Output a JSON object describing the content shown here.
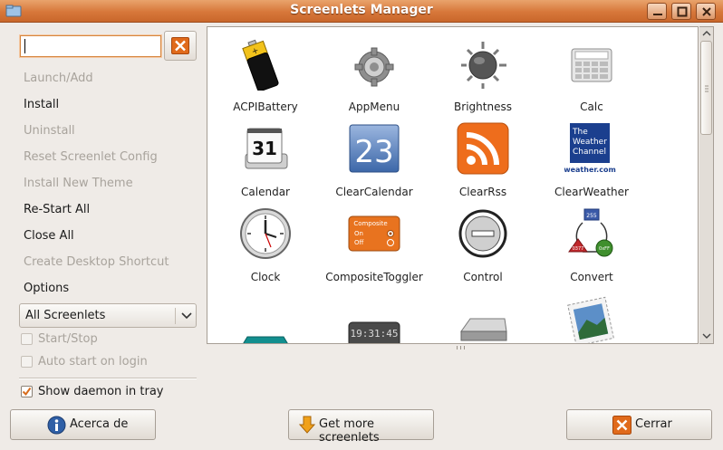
{
  "window": {
    "title": "Screenlets Manager"
  },
  "search": {
    "value": "",
    "placeholder": ""
  },
  "menu": [
    {
      "label": "Launch/Add",
      "enabled": false
    },
    {
      "label": "Install",
      "enabled": true
    },
    {
      "label": "Uninstall",
      "enabled": false
    },
    {
      "label": "Reset Screenlet Config",
      "enabled": false
    },
    {
      "label": "Install New Theme",
      "enabled": false
    },
    {
      "label": "Re-Start All",
      "enabled": true
    },
    {
      "label": "Close All",
      "enabled": true
    },
    {
      "label": "Create Desktop Shortcut",
      "enabled": false
    },
    {
      "label": "Options",
      "enabled": true
    }
  ],
  "filter": {
    "selected": "All Screenlets"
  },
  "options": {
    "start_stop": {
      "label": "Start/Stop",
      "checked": false,
      "enabled": false
    },
    "auto_start": {
      "label": "Auto start on login",
      "checked": false,
      "enabled": false
    },
    "daemon": {
      "label": "Show daemon in tray",
      "checked": true,
      "enabled": true
    }
  },
  "screenlets": [
    {
      "name": "ACPIBattery",
      "icon": "battery-icon"
    },
    {
      "name": "AppMenu",
      "icon": "gear-icon"
    },
    {
      "name": "Brightness",
      "icon": "brightness-icon"
    },
    {
      "name": "Calc",
      "icon": "calculator-icon"
    },
    {
      "name": "Calendar",
      "icon": "calendar-icon",
      "text": "31"
    },
    {
      "name": "ClearCalendar",
      "icon": "clear-calendar-icon",
      "text": "23"
    },
    {
      "name": "ClearRss",
      "icon": "rss-icon"
    },
    {
      "name": "ClearWeather",
      "icon": "weather-channel-icon",
      "text": [
        "The",
        "Weather",
        "Channel",
        "weather.com"
      ]
    },
    {
      "name": "Clock",
      "icon": "clock-icon"
    },
    {
      "name": "CompositeToggler",
      "icon": "composite-toggler-icon",
      "text": [
        "Composite",
        "On",
        "Off"
      ]
    },
    {
      "name": "Control",
      "icon": "control-icon"
    },
    {
      "name": "Convert",
      "icon": "convert-icon",
      "text": [
        "255",
        "0xFF",
        "0377"
      ]
    },
    {
      "name": "",
      "icon": "partial-teal-icon"
    },
    {
      "name": "",
      "icon": "digital-clock-icon",
      "text": "19:31:45"
    },
    {
      "name": "",
      "icon": "drive-icon"
    },
    {
      "name": "",
      "icon": "stamp-photo-icon"
    }
  ],
  "buttons": {
    "about": {
      "label": "Acerca de",
      "icon": "info-icon"
    },
    "get_more": {
      "label": "Get more screenlets",
      "icon": "download-arrow-icon"
    },
    "close": {
      "label": "Cerrar",
      "icon": "close-icon"
    }
  },
  "colors": {
    "titlebar": "#d7773a",
    "accent": "#e06a1b",
    "window_bg": "#efebe7"
  }
}
